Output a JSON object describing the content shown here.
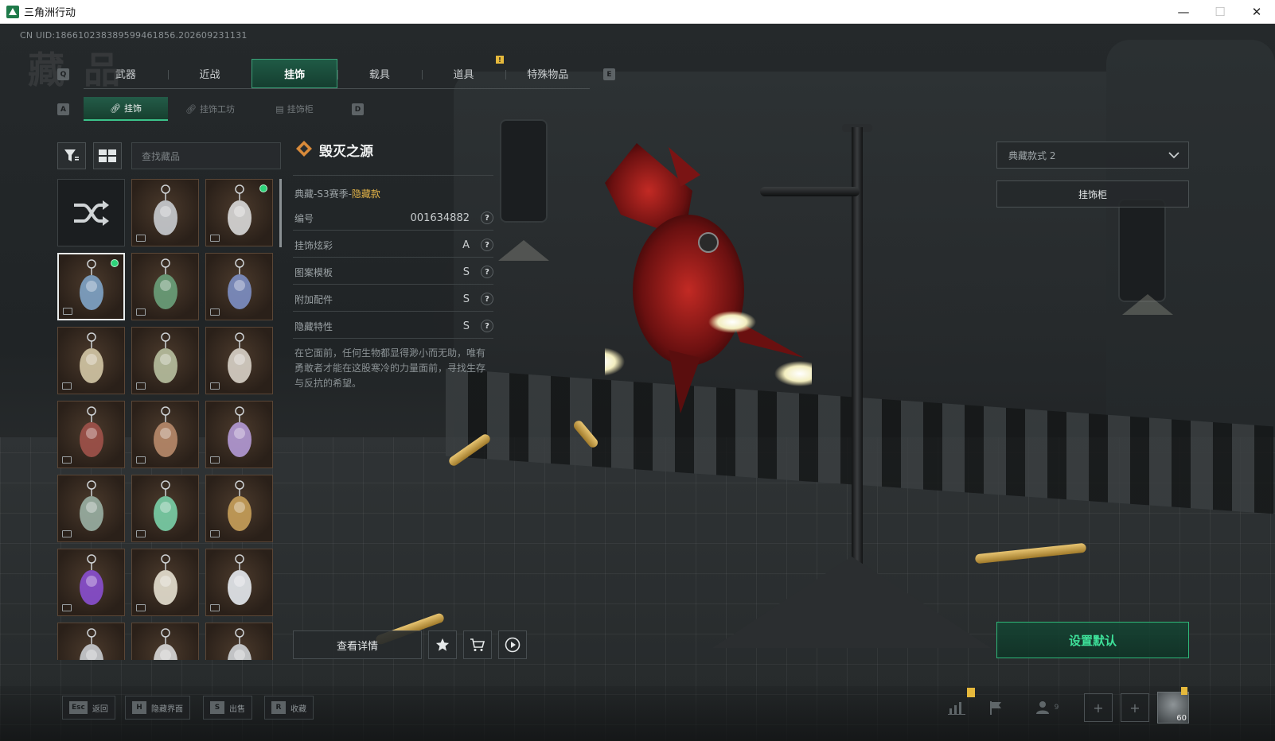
{
  "window": {
    "title": "三角洲行动",
    "minimize": "—",
    "maximize": "☐",
    "close": "✕"
  },
  "header": {
    "uid": "CN UID:186610238389599461856.202609231131",
    "watermark": "藏 品",
    "notification": "!"
  },
  "main_tabs": {
    "key_prev": "Q",
    "key_next": "E",
    "items": [
      {
        "label": "武器"
      },
      {
        "label": "近战"
      },
      {
        "label": "挂饰",
        "active": true
      },
      {
        "label": "载具"
      },
      {
        "label": "道具"
      },
      {
        "label": "特殊物品"
      }
    ]
  },
  "sub_tabs": {
    "key_prev": "A",
    "key_next": "D",
    "items": [
      {
        "label": "挂饰",
        "active": true
      },
      {
        "label": "挂饰工坊"
      },
      {
        "label": "挂饰柜"
      }
    ]
  },
  "toolbar": {
    "search_placeholder": "查找藏品",
    "filter_icon": "filter-icon",
    "grid_view_icon": "grid-view-icon"
  },
  "grid": {
    "items": [
      {
        "kind": "shuffle",
        "icon": "shuffle-icon"
      },
      {
        "kind": "charm",
        "color": "#c9ccd0"
      },
      {
        "kind": "charm",
        "color": "#d9d9d9",
        "badge": true
      },
      {
        "kind": "charm",
        "color": "#7fa4c8",
        "badge": true,
        "selected": true
      },
      {
        "kind": "charm",
        "color": "#6aa07a"
      },
      {
        "kind": "charm",
        "color": "#7d8fc4"
      },
      {
        "kind": "charm",
        "color": "#d4c8a6"
      },
      {
        "kind": "charm",
        "color": "#b8c0a0"
      },
      {
        "kind": "charm",
        "color": "#d8d2c8"
      },
      {
        "kind": "charm",
        "color": "#a0524a"
      },
      {
        "kind": "charm",
        "color": "#b88a6a"
      },
      {
        "kind": "charm",
        "color": "#b49ad6"
      },
      {
        "kind": "charm",
        "color": "#9ab0a4"
      },
      {
        "kind": "charm",
        "color": "#7ad0a8"
      },
      {
        "kind": "charm",
        "color": "#c8a05a"
      },
      {
        "kind": "charm",
        "color": "#8a4fd0"
      },
      {
        "kind": "charm",
        "color": "#e6e0d0"
      },
      {
        "kind": "charm",
        "color": "#e6eaf0"
      },
      {
        "kind": "charm",
        "color": "#c9ccd0"
      },
      {
        "kind": "charm",
        "color": "#d8d8d8"
      },
      {
        "kind": "charm",
        "color": "#cfd3d6"
      }
    ]
  },
  "detail": {
    "title": "毁灭之源",
    "season_prefix": "典藏-S3赛季-",
    "season_tag": "隐藏款",
    "attributes": [
      {
        "label": "编号",
        "value": "001634882"
      },
      {
        "label": "挂饰炫彩",
        "value": "A"
      },
      {
        "label": "图案模板",
        "value": "S"
      },
      {
        "label": "附加配件",
        "value": "S"
      },
      {
        "label": "隐藏特性",
        "value": "S"
      }
    ],
    "help_glyph": "?",
    "description": "在它面前，任何生物都显得渺小而无助，唯有勇敢者才能在这股寒冷的力量面前，寻找生存与反抗的希望。",
    "view_button": "查看详情",
    "actions": [
      {
        "name": "favorite-icon"
      },
      {
        "name": "cart-icon"
      },
      {
        "name": "play-icon"
      }
    ]
  },
  "right_panel": {
    "style_select": "典藏款式 2",
    "cabinet_button": "挂饰柜",
    "default_button": "设置默认"
  },
  "bottom_bar": {
    "hotkeys": [
      {
        "key": "Esc",
        "label": "返回"
      },
      {
        "key": "H",
        "label": "隐藏界面"
      },
      {
        "key": "S",
        "label": "出售"
      },
      {
        "key": "R",
        "label": "收藏"
      }
    ],
    "friends_count": "9",
    "avatar_level": "60"
  },
  "colors": {
    "accent_green": "#3ee19a",
    "accent_gold": "#e3b347",
    "badge_green": "#2ed47a"
  }
}
